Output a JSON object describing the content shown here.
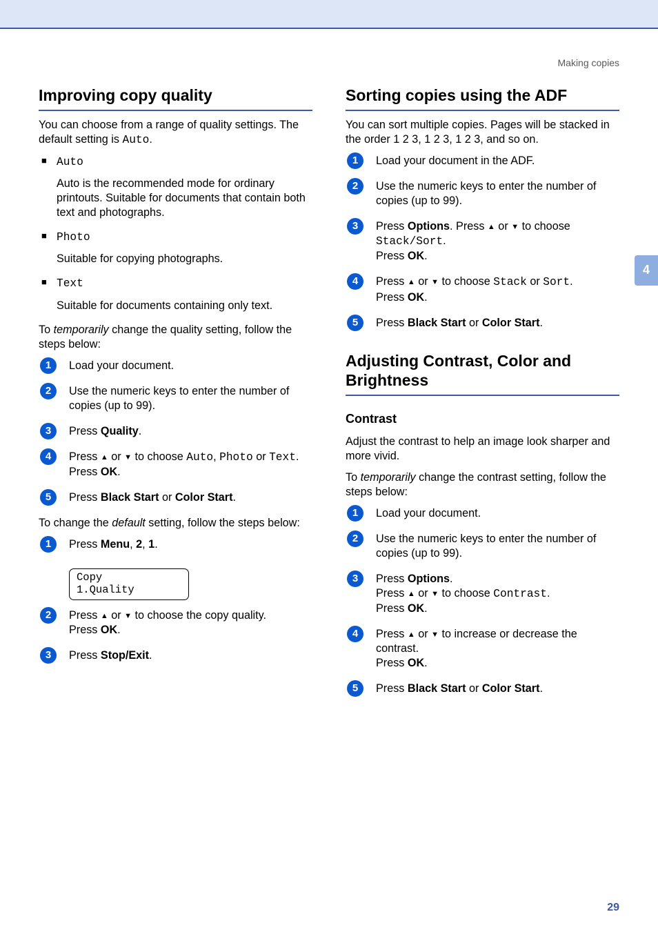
{
  "header": {
    "breadcrumb": "Making copies"
  },
  "side_tab": "4",
  "page_number": "29",
  "left": {
    "h_improving": "Improving copy quality",
    "intro_pre": "You can choose from a range of quality settings. The default setting is ",
    "intro_auto": "Auto",
    "intro_post": ".",
    "modes": {
      "auto_label": "Auto",
      "auto_desc": "Auto is the recommended mode for ordinary printouts. Suitable for documents that contain both text and photographs.",
      "photo_label": "Photo",
      "photo_desc": "Suitable for copying photographs.",
      "text_label": "Text",
      "text_desc": "Suitable for documents containing only text."
    },
    "temp_pre": "To ",
    "temp_em": "temporarily",
    "temp_post": " change the quality setting, follow the steps below:",
    "steps1": {
      "s1": "Load your document.",
      "s2": "Use the numeric keys to enter the number of copies (up to 99).",
      "s3_pre": "Press ",
      "s3_b": "Quality",
      "s3_post": ".",
      "s4_pre": "Press ",
      "s4_mid": " or ",
      "s4_mid2": " to choose ",
      "s4_auto": "Auto",
      "s4_sep1": ", ",
      "s4_photo": "Photo",
      "s4_sep2": " or ",
      "s4_text": "Text",
      "s4_post": ".",
      "s4_line2_pre": "Press ",
      "s4_line2_b": "OK",
      "s4_line2_post": ".",
      "s5_pre": "Press ",
      "s5_b1": "Black Start",
      "s5_mid": " or ",
      "s5_b2": "Color Start",
      "s5_post": "."
    },
    "default_pre": "To change the ",
    "default_em": "default",
    "default_post": " setting, follow the steps below:",
    "steps2": {
      "s1_pre": "Press ",
      "s1_b1": "Menu",
      "s1_sep1": ", ",
      "s1_b2": "2",
      "s1_sep2": ", ",
      "s1_b3": "1",
      "s1_post": ".",
      "lcd_line1": "Copy",
      "lcd_line2": "1.Quality",
      "s2_pre": "Press ",
      "s2_mid": " or ",
      "s2_post": " to choose the copy quality.",
      "s2_line2_pre": "Press ",
      "s2_line2_b": "OK",
      "s2_line2_post": ".",
      "s3_pre": "Press ",
      "s3_b": "Stop/Exit",
      "s3_post": "."
    }
  },
  "right": {
    "h_sorting": "Sorting copies using the ADF",
    "sort_intro": "You can sort multiple copies. Pages will be stacked in the order 1 2 3, 1 2 3, 1 2 3, and so on.",
    "sort_steps": {
      "s1": "Load your document in the ADF.",
      "s2": "Use the numeric keys to enter the number of copies (up to 99).",
      "s3_pre": "Press ",
      "s3_b": "Options",
      "s3_mid1": ". Press ",
      "s3_mid2": " or ",
      "s3_mid3": " to choose ",
      "s3_mono": "Stack/Sort",
      "s3_post": ".",
      "s3_line2_pre": "Press ",
      "s3_line2_b": "OK",
      "s3_line2_post": ".",
      "s4_pre": "Press ",
      "s4_mid1": " or ",
      "s4_mid2": " to choose ",
      "s4_mono1": "Stack",
      "s4_mid3": " or ",
      "s4_mono2": "Sort",
      "s4_post": ".",
      "s4_line2_pre": "Press ",
      "s4_line2_b": "OK",
      "s4_line2_post": ".",
      "s5_pre": "Press ",
      "s5_b1": "Black Start",
      "s5_mid": " or ",
      "s5_b2": "Color Start",
      "s5_post": "."
    },
    "h_adjusting": "Adjusting Contrast, Color and Brightness",
    "h_contrast": "Contrast",
    "contrast_intro": "Adjust the contrast to help an image look sharper and more vivid.",
    "contrast_temp_pre": "To ",
    "contrast_temp_em": "temporarily",
    "contrast_temp_post": " change the contrast setting, follow the steps below:",
    "contrast_steps": {
      "s1": "Load your document.",
      "s2": "Use the numeric keys to enter the number of copies (up to 99).",
      "s3_pre": "Press ",
      "s3_b": "Options",
      "s3_post": ".",
      "s3_line2_pre": "Press ",
      "s3_line2_mid1": " or ",
      "s3_line2_mid2": " to choose ",
      "s3_line2_mono": "Contrast",
      "s3_line2_post": ".",
      "s3_line3_pre": "Press ",
      "s3_line3_b": "OK",
      "s3_line3_post": ".",
      "s4_pre": "Press ",
      "s4_mid": " or ",
      "s4_post": " to increase or decrease the contrast.",
      "s4_line2_pre": "Press ",
      "s4_line2_b": "OK",
      "s4_line2_post": ".",
      "s5_pre": "Press ",
      "s5_b1": "Black Start",
      "s5_mid": " or ",
      "s5_b2": "Color Start",
      "s5_post": "."
    }
  }
}
